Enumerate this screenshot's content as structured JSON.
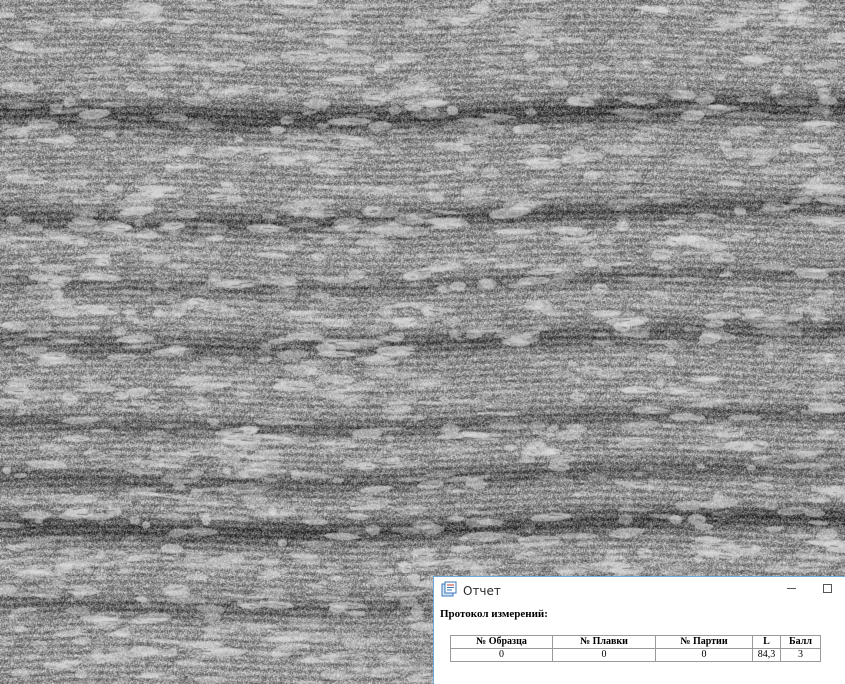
{
  "window": {
    "title": "Отчет",
    "icon": "report-app-icon"
  },
  "report": {
    "heading": "Протокол измерений:",
    "columns": [
      "№ Образца",
      "№ Плавки",
      "№ Партии",
      "L",
      "Балл"
    ],
    "rows": [
      [
        "0",
        "0",
        "0",
        "84,3",
        "3"
      ]
    ]
  },
  "colors": {
    "window_border": "#6ea8d8",
    "table_border": "#9a9a9a"
  }
}
